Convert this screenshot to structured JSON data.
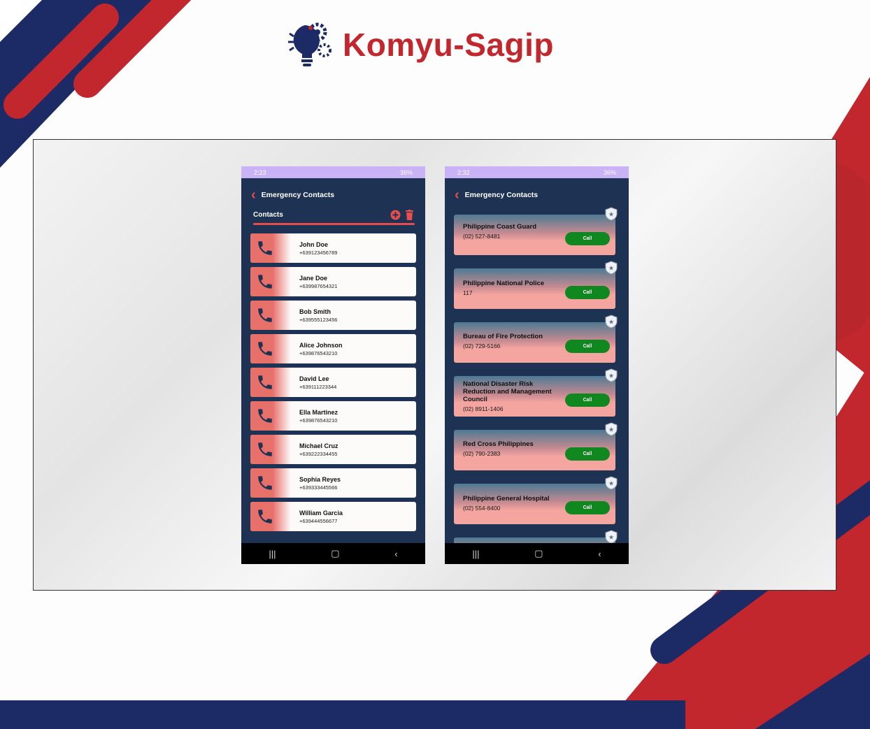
{
  "brand": {
    "name": "Komyu-Sagip",
    "logo_icon": "lightbulb-gears-icon"
  },
  "colors": {
    "navy": "#1c2b66",
    "red": "#c1272d",
    "phone_bg": "#1e3354",
    "status_bar": "#c9b2f5",
    "accent": "#e84c4c",
    "call_green": "#10881f"
  },
  "phone1": {
    "status": {
      "time": "2:23",
      "battery": "36%"
    },
    "title": "Emergency Contacts",
    "section_label": "Contacts",
    "contacts": [
      {
        "name": "John Doe",
        "number": "+639123456789"
      },
      {
        "name": "Jane Doe",
        "number": "+639987654321"
      },
      {
        "name": "Bob Smith",
        "number": "+639555123456"
      },
      {
        "name": "Alice Johnson",
        "number": "+639876543210"
      },
      {
        "name": "David Lee",
        "number": "+639111223344"
      },
      {
        "name": "Ella Martinez",
        "number": "+639876543210"
      },
      {
        "name": "Michael Cruz",
        "number": "+639222334455"
      },
      {
        "name": "Sophia Reyes",
        "number": "+639333445566"
      },
      {
        "name": "William Garcia",
        "number": "+639444556677"
      }
    ]
  },
  "phone2": {
    "status": {
      "time": "2:32",
      "battery": "36%"
    },
    "title": "Emergency Contacts",
    "call_label": "Call",
    "hotlines": [
      {
        "name": "Philippine Coast Guard",
        "number": "(02) 527-8481"
      },
      {
        "name": "Philippine National Police",
        "number": "117"
      },
      {
        "name": "Bureau of Fire Protection",
        "number": "(02) 729-5166"
      },
      {
        "name": "National Disaster Risk Reduction and Management Council",
        "number": "(02) 8911-1406"
      },
      {
        "name": "Red Cross Philippines",
        "number": "(02) 790-2383"
      },
      {
        "name": "Philippine General Hospital",
        "number": "(02) 554-8400"
      }
    ]
  }
}
